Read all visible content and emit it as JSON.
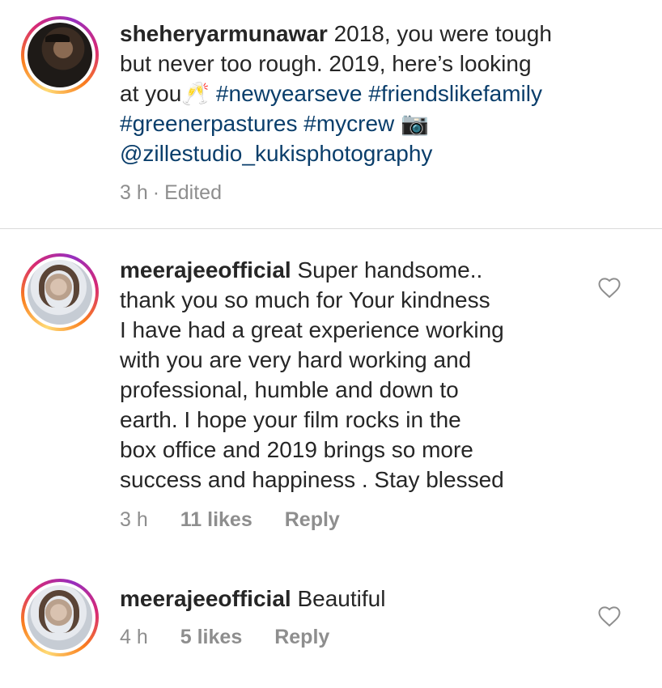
{
  "caption": {
    "username": "sheheryarmunawar",
    "text_plain": " 2018, you were tough\nbut never too rough.  2019, here’s looking\nat you🥂 ",
    "hashtags_line1": "#newyearseve #friendslikefamily",
    "hashtags_line2": "#greenerpastures #mycrew 📷",
    "mention": "@zillestudio_kukisphotography",
    "time": "3 h",
    "separator": "·",
    "edited": "Edited"
  },
  "comments": [
    {
      "username": "meerajeeofficial",
      "text": " Super handsome..\nthank you so much for Your kindness\nI have had a great experience working\nwith you are very hard working and\nprofessional, humble and down to\nearth. I hope your film rocks in the\nbox office and 2019 brings so more\nsuccess and happiness . Stay blessed",
      "time": "3 h",
      "likes": "11 likes",
      "reply": "Reply"
    },
    {
      "username": "meerajeeofficial",
      "text": " Beautiful",
      "time": "4 h",
      "likes": "5 likes",
      "reply": "Reply"
    }
  ],
  "icons": {
    "like": "heart-outline-icon"
  },
  "colors": {
    "hashtag": "#0a3e6b",
    "meta": "#8e8e8e",
    "text": "#262626"
  }
}
